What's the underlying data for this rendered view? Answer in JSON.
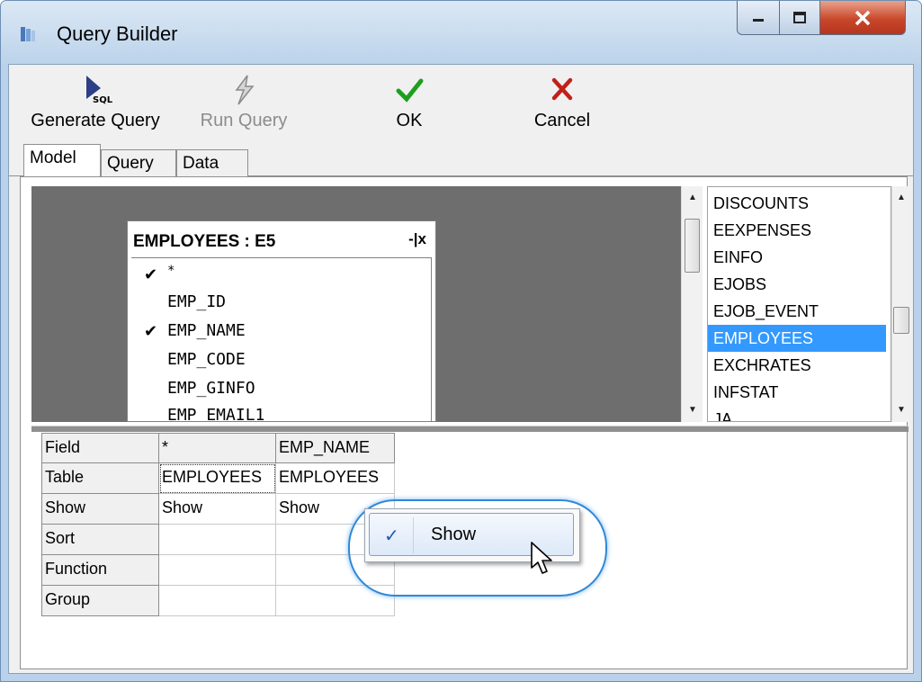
{
  "window": {
    "title": "Query Builder"
  },
  "toolbar": {
    "generate_label": "Generate Query",
    "run_label": "Run Query",
    "ok_label": "OK",
    "cancel_label": "Cancel",
    "generate_icon_text": "SQL"
  },
  "tabs": [
    {
      "label": "Model"
    },
    {
      "label": "Query"
    },
    {
      "label": "Data"
    }
  ],
  "model": {
    "table_box": {
      "title": "EMPLOYEES : E5",
      "buttons": "-|x",
      "columns": [
        {
          "name": "*",
          "checked": true
        },
        {
          "name": "EMP_ID",
          "checked": false
        },
        {
          "name": "EMP_NAME",
          "checked": true
        },
        {
          "name": "EMP_CODE",
          "checked": false
        },
        {
          "name": "EMP_GINFO",
          "checked": false
        },
        {
          "name": "EMP_EMAIL1",
          "checked": false
        }
      ]
    },
    "table_list": {
      "items": [
        "DISCOUNTS",
        "EEXPENSES",
        "EINFO",
        "EJOBS",
        "EJOB_EVENT",
        "EMPLOYEES",
        "EXCHRATES",
        "INFSTAT",
        "JA"
      ],
      "selected": "EMPLOYEES"
    }
  },
  "grid": {
    "row_headers": [
      "Field",
      "Table",
      "Show",
      "Sort",
      "Function",
      "Group"
    ],
    "columns": [
      {
        "field": "*",
        "table": "EMPLOYEES",
        "show": "Show"
      },
      {
        "field": "EMP_NAME",
        "table": "EMPLOYEES",
        "show": "Show"
      }
    ]
  },
  "context_menu": {
    "item_label": "Show",
    "checked": true
  },
  "colors": {
    "selection": "#3399ff",
    "canvas": "#6e6e6e",
    "highlight_ring": "#2f88d8",
    "ok_green": "#1e9e1e",
    "cancel_red": "#c0201a"
  }
}
